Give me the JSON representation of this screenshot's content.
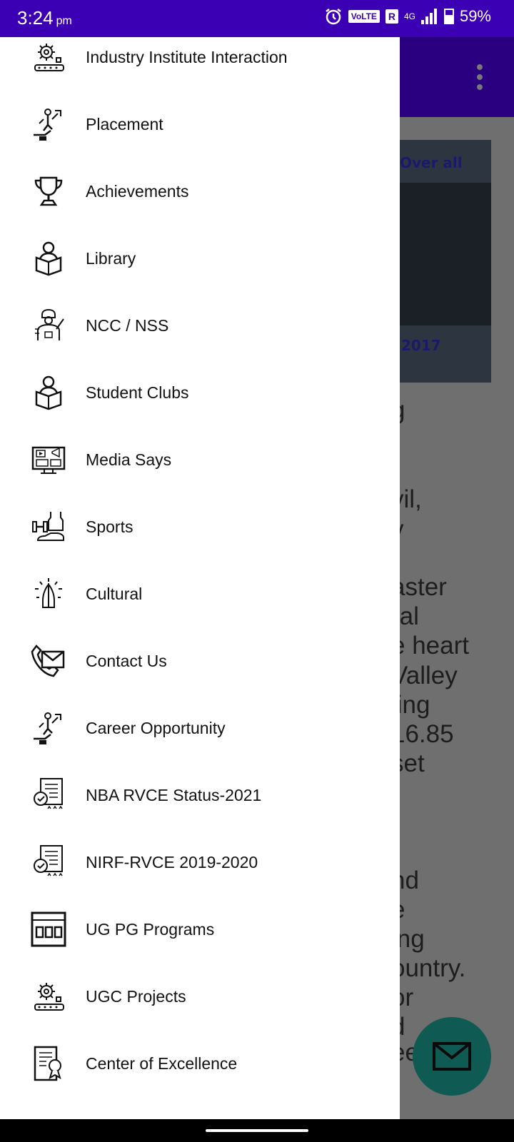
{
  "status": {
    "time": "3:24",
    "ampm": "pm",
    "volte": "VoLTE",
    "roaming": "R",
    "network": "4G",
    "battery": "59%"
  },
  "background": {
    "hero_caption_top": "Over all",
    "hero_caption_bottom": "2017",
    "text_lines": [
      "g",
      "vil,",
      "y",
      "aster",
      "ral",
      "e heart",
      "Valley",
      "ling",
      "16.85",
      "set",
      "nd",
      "e",
      "ing",
      "ountry.",
      "or",
      "d",
      "ee"
    ]
  },
  "drawer": {
    "items": [
      {
        "label": "Industry Institute Interaction",
        "icon": "industry-gear-icon"
      },
      {
        "label": "Placement",
        "icon": "career-growth-icon"
      },
      {
        "label": "Achievements",
        "icon": "trophy-icon"
      },
      {
        "label": "Library",
        "icon": "reader-book-icon"
      },
      {
        "label": "NCC / NSS",
        "icon": "soldier-icon"
      },
      {
        "label": "Student Clubs",
        "icon": "reader-book-icon"
      },
      {
        "label": "Media Says",
        "icon": "media-screen-icon"
      },
      {
        "label": "Sports",
        "icon": "sports-gear-icon"
      },
      {
        "label": "Cultural",
        "icon": "praying-hands-icon"
      },
      {
        "label": "Contact Us",
        "icon": "phone-mail-icon"
      },
      {
        "label": "Career Opportunity",
        "icon": "career-growth-icon"
      },
      {
        "label": "NBA RVCE Status-2021",
        "icon": "certificate-icon"
      },
      {
        "label": "NIRF-RVCE 2019-2020",
        "icon": "certificate-icon"
      },
      {
        "label": "UG PG Programs",
        "icon": "programs-board-icon"
      },
      {
        "label": "UGC Projects",
        "icon": "industry-gear-icon"
      },
      {
        "label": "Center of Excellence",
        "icon": "award-document-icon"
      }
    ]
  },
  "fab": {
    "icon": "mail-icon"
  }
}
